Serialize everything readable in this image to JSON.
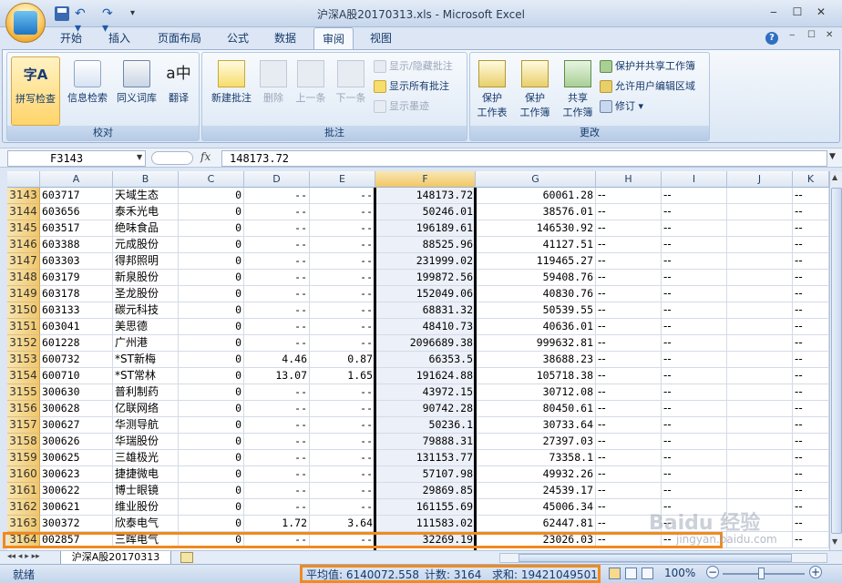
{
  "window": {
    "title": "沪深A股20170313.xls - Microsoft Excel",
    "minimize": "‒",
    "maximize": "☐",
    "close": "✕"
  },
  "qat": {
    "undo": "↶ ▾",
    "redo": "↷ ▾",
    "more": "▾"
  },
  "tabs": [
    "开始",
    "插入",
    "页面布局",
    "公式",
    "数据",
    "审阅",
    "视图"
  ],
  "active_tab": "审阅",
  "help": "?",
  "ribbon": {
    "proofing": {
      "label": "校对",
      "spell": "拼写检查",
      "research": "信息检索",
      "thesaurus": "同义词库",
      "translate": "翻译"
    },
    "comments": {
      "label": "批注",
      "new": "新建批注",
      "delete": "删除",
      "prev": "上一条",
      "next": "下一条",
      "show_hide": "显示/隐藏批注",
      "show_all": "显示所有批注",
      "show_ink": "显示墨迹"
    },
    "changes": {
      "label": "更改",
      "protect_sheet_1": "保护",
      "protect_sheet_2": "工作表",
      "protect_wb_1": "保护",
      "protect_wb_2": "工作簿",
      "share_wb_1": "共享",
      "share_wb_2": "工作簿",
      "protect_share": "保护并共享工作簿",
      "allow_edit": "允许用户编辑区域",
      "track": "修订"
    }
  },
  "formula_bar": {
    "name_box": "F3143",
    "fx": "fx",
    "value": "148173.72"
  },
  "columns": [
    "A",
    "B",
    "C",
    "D",
    "E",
    "F",
    "G",
    "H",
    "I",
    "J",
    "K"
  ],
  "selected_column": "F",
  "rows": [
    {
      "r": "3143",
      "a": "603717",
      "b": "天域生态",
      "c": "0",
      "d": "--",
      "e": "--",
      "f": "148173.72",
      "g": "60061.28",
      "h": "--",
      "i": "--",
      "k": "--"
    },
    {
      "r": "3144",
      "a": "603656",
      "b": "泰禾光电",
      "c": "0",
      "d": "--",
      "e": "--",
      "f": "50246.01",
      "g": "38576.01",
      "h": "--",
      "i": "--",
      "k": "--"
    },
    {
      "r": "3145",
      "a": "603517",
      "b": "绝味食品",
      "c": "0",
      "d": "--",
      "e": "--",
      "f": "196189.61",
      "g": "146530.92",
      "h": "--",
      "i": "--",
      "k": "--"
    },
    {
      "r": "3146",
      "a": "603388",
      "b": "元成股份",
      "c": "0",
      "d": "--",
      "e": "--",
      "f": "88525.96",
      "g": "41127.51",
      "h": "--",
      "i": "--",
      "k": "--"
    },
    {
      "r": "3147",
      "a": "603303",
      "b": "得邦照明",
      "c": "0",
      "d": "--",
      "e": "--",
      "f": "231999.02",
      "g": "119465.27",
      "h": "--",
      "i": "--",
      "k": "--"
    },
    {
      "r": "3148",
      "a": "603179",
      "b": "新泉股份",
      "c": "0",
      "d": "--",
      "e": "--",
      "f": "199872.56",
      "g": "59408.76",
      "h": "--",
      "i": "--",
      "k": "--"
    },
    {
      "r": "3149",
      "a": "603178",
      "b": "圣龙股份",
      "c": "0",
      "d": "--",
      "e": "--",
      "f": "152049.06",
      "g": "40830.76",
      "h": "--",
      "i": "--",
      "k": "--"
    },
    {
      "r": "3150",
      "a": "603133",
      "b": "碳元科技",
      "c": "0",
      "d": "--",
      "e": "--",
      "f": "68831.32",
      "g": "50539.55",
      "h": "--",
      "i": "--",
      "k": "--"
    },
    {
      "r": "3151",
      "a": "603041",
      "b": "美思德",
      "c": "0",
      "d": "--",
      "e": "--",
      "f": "48410.73",
      "g": "40636.01",
      "h": "--",
      "i": "--",
      "k": "--"
    },
    {
      "r": "3152",
      "a": "601228",
      "b": "广州港",
      "c": "0",
      "d": "--",
      "e": "--",
      "f": "2096689.38",
      "g": "999632.81",
      "h": "--",
      "i": "--",
      "k": "--"
    },
    {
      "r": "3153",
      "a": "600732",
      "b": "*ST新梅",
      "c": "0",
      "d": "4.46",
      "e": "0.87",
      "f": "66353.5",
      "g": "38688.23",
      "h": "--",
      "i": "--",
      "k": "--"
    },
    {
      "r": "3154",
      "a": "600710",
      "b": "*ST常林",
      "c": "0",
      "d": "13.07",
      "e": "1.65",
      "f": "191624.88",
      "g": "105718.38",
      "h": "--",
      "i": "--",
      "k": "--"
    },
    {
      "r": "3155",
      "a": "300630",
      "b": "普利制药",
      "c": "0",
      "d": "--",
      "e": "--",
      "f": "43972.15",
      "g": "30712.08",
      "h": "--",
      "i": "--",
      "k": "--"
    },
    {
      "r": "3156",
      "a": "300628",
      "b": "亿联网络",
      "c": "0",
      "d": "--",
      "e": "--",
      "f": "90742.28",
      "g": "80450.61",
      "h": "--",
      "i": "--",
      "k": "--"
    },
    {
      "r": "3157",
      "a": "300627",
      "b": "华测导航",
      "c": "0",
      "d": "--",
      "e": "--",
      "f": "50236.1",
      "g": "30733.64",
      "h": "--",
      "i": "--",
      "k": "--"
    },
    {
      "r": "3158",
      "a": "300626",
      "b": "华瑞股份",
      "c": "0",
      "d": "--",
      "e": "--",
      "f": "79888.31",
      "g": "27397.03",
      "h": "--",
      "i": "--",
      "k": "--"
    },
    {
      "r": "3159",
      "a": "300625",
      "b": "三雄极光",
      "c": "0",
      "d": "--",
      "e": "--",
      "f": "131153.77",
      "g": "73358.1",
      "h": "--",
      "i": "--",
      "k": "--"
    },
    {
      "r": "3160",
      "a": "300623",
      "b": "捷捷微电",
      "c": "0",
      "d": "--",
      "e": "--",
      "f": "57107.98",
      "g": "49932.26",
      "h": "--",
      "i": "--",
      "k": "--"
    },
    {
      "r": "3161",
      "a": "300622",
      "b": "博士眼镜",
      "c": "0",
      "d": "--",
      "e": "--",
      "f": "29869.85",
      "g": "24539.17",
      "h": "--",
      "i": "--",
      "k": "--"
    },
    {
      "r": "3162",
      "a": "300621",
      "b": "维业股份",
      "c": "0",
      "d": "--",
      "e": "--",
      "f": "161155.69",
      "g": "45006.34",
      "h": "--",
      "i": "--",
      "k": "--"
    },
    {
      "r": "3163",
      "a": "300372",
      "b": "欣泰电气",
      "c": "0",
      "d": "1.72",
      "e": "3.64",
      "f": "111583.02",
      "g": "62447.81",
      "h": "--",
      "i": "--",
      "k": "--"
    },
    {
      "r": "3164",
      "a": "002857",
      "b": "三晖电气",
      "c": "0",
      "d": "--",
      "e": "--",
      "f": "32269.19",
      "g": "23026.03",
      "h": "--",
      "i": "--",
      "k": "--"
    }
  ],
  "sheet_tab": "沪深A股20170313",
  "sheet_nav": "◂◂ ◂ ▸ ▸▸",
  "status": {
    "ready": "就绪",
    "average": "平均值: 6140072.558",
    "count": "计数: 3164",
    "sum": "求和: 19421049501",
    "zoom": "100%",
    "zoom_out": "−",
    "zoom_in": "+"
  },
  "watermark": {
    "brand": "Baidu 经验",
    "url": "jingyan.baidu.com"
  },
  "colors": {
    "accent": "#f08a1e",
    "selected_header": "#f2c765",
    "ribbon": "#dbe7f5"
  }
}
